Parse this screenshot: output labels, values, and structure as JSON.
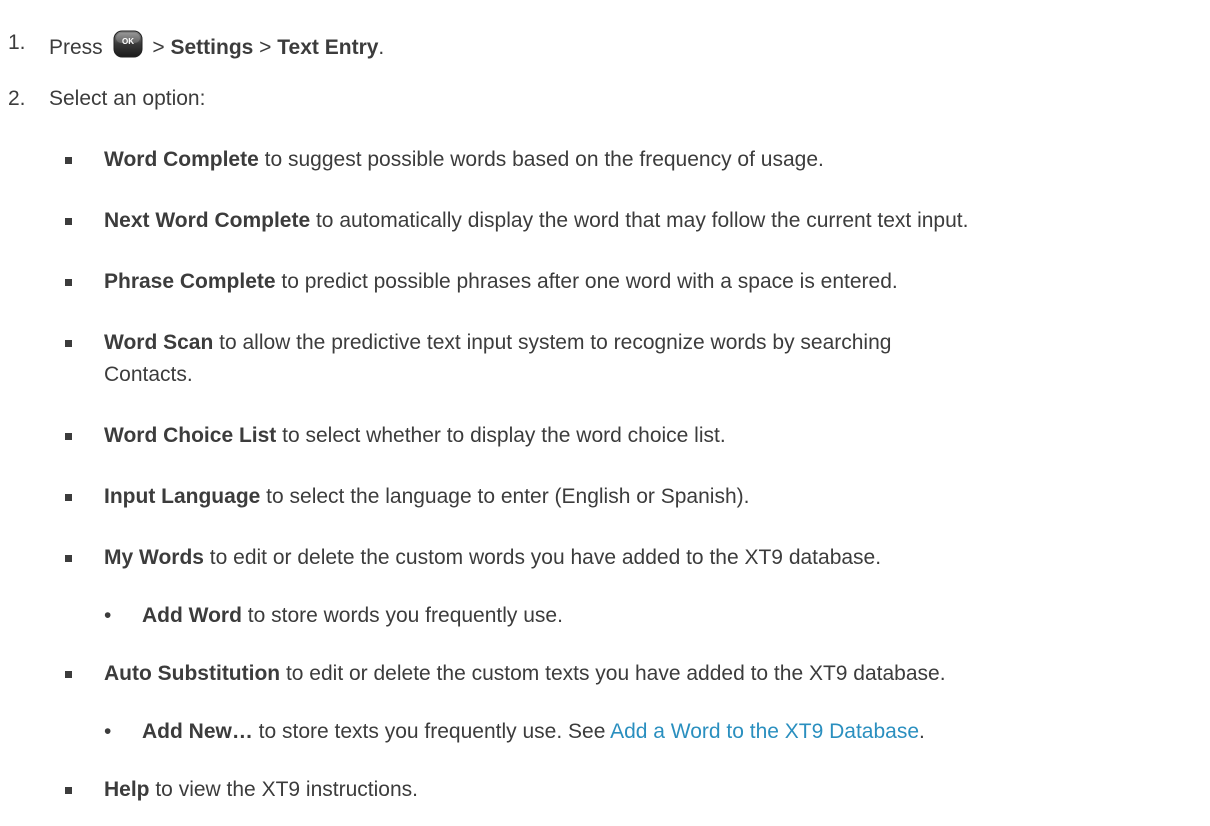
{
  "steps": [
    {
      "number": "1.",
      "prefix": "Press",
      "icon": "ok-key-icon",
      "icon_label": "OK",
      "sep1": ">",
      "part1": "Settings",
      "sep2": ">",
      "part2": "Text Entry",
      "suffix": "."
    },
    {
      "number": "2.",
      "text": "Select an option:"
    }
  ],
  "options": [
    {
      "term": "Word Complete",
      "desc": " to suggest possible words based on the frequency of usage."
    },
    {
      "term": "Next Word Complete",
      "desc": " to automatically display the word that may follow the current text input."
    },
    {
      "term": "Phrase Complete",
      "desc": " to predict possible phrases after one word with a space is entered."
    },
    {
      "term": "Word Scan",
      "desc": " to allow the predictive text input system to recognize words by searching",
      "desc2": "Contacts."
    },
    {
      "term": "Word Choice List",
      "desc": " to select whether to display the word choice list."
    },
    {
      "term": "Input Language",
      "desc": " to select the language to enter (English or Spanish)."
    },
    {
      "term": "My Words",
      "desc": " to edit or delete the custom words you have added to the XT9 database."
    },
    {
      "term": "Add Word",
      "desc": " to store words you frequently use."
    },
    {
      "term": "Auto Substitution",
      "desc": " to edit or delete the custom texts you have added to the XT9 database."
    },
    {
      "term": "Add New…",
      "desc": " to store texts you frequently use. See ",
      "link": "Add a Word to the XT9 Database",
      "after": "."
    },
    {
      "term": "Help",
      "desc": " to view the XT9 instructions."
    }
  ],
  "colors": {
    "text": "#3c3c3c",
    "link": "#2a8fbf"
  }
}
